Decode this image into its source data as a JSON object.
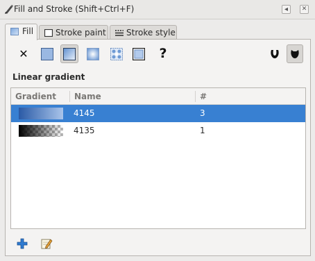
{
  "window": {
    "title": "Fill and Stroke (Shift+Ctrl+F)"
  },
  "title_buttons": {
    "dock_glyph": "◂",
    "close_glyph": "✕"
  },
  "tabs": [
    {
      "label": "Fill",
      "icon": "fill-tab-icon",
      "active": true
    },
    {
      "label": "Stroke paint",
      "icon": "stroke-paint-tab-icon",
      "active": false
    },
    {
      "label": "Stroke style",
      "icon": "stroke-style-tab-icon",
      "active": false
    }
  ],
  "paint_modes": {
    "none_glyph": "✕",
    "unset_glyph": "?",
    "items": [
      {
        "name": "no-paint",
        "icon": "x-icon"
      },
      {
        "name": "flat-color",
        "icon": "flat-color-icon"
      },
      {
        "name": "linear-gradient",
        "icon": "linear-gradient-icon",
        "pressed": true
      },
      {
        "name": "radial-gradient",
        "icon": "radial-gradient-icon"
      },
      {
        "name": "pattern",
        "icon": "pattern-icon"
      },
      {
        "name": "swatch",
        "icon": "swatch-icon"
      },
      {
        "name": "unset-paint",
        "icon": "question-mark-icon"
      }
    ],
    "fill_rules": [
      {
        "name": "fill-rule-evenodd",
        "icon": "evenodd-icon"
      },
      {
        "name": "fill-rule-nonzero",
        "icon": "nonzero-icon",
        "pressed": true
      }
    ]
  },
  "section": {
    "title": "Linear gradient"
  },
  "gradient_table": {
    "headers": {
      "gradient": "Gradient",
      "name": "Name",
      "count": "#"
    },
    "rows": [
      {
        "name": "4145",
        "count": "3",
        "selected": true,
        "swatch": "blue-gradient"
      },
      {
        "name": "4135",
        "count": "1",
        "selected": false,
        "swatch": "black-to-transparent-gradient"
      }
    ]
  },
  "footer": [
    {
      "name": "add-gradient",
      "icon": "plus-icon"
    },
    {
      "name": "edit-gradient",
      "icon": "edit-icon"
    }
  ],
  "colors": {
    "selection": "#3880d2",
    "gradient_start": "#2a5aa6",
    "gradient_end": "#a9c4ea",
    "plus": "#2f7bd1"
  }
}
